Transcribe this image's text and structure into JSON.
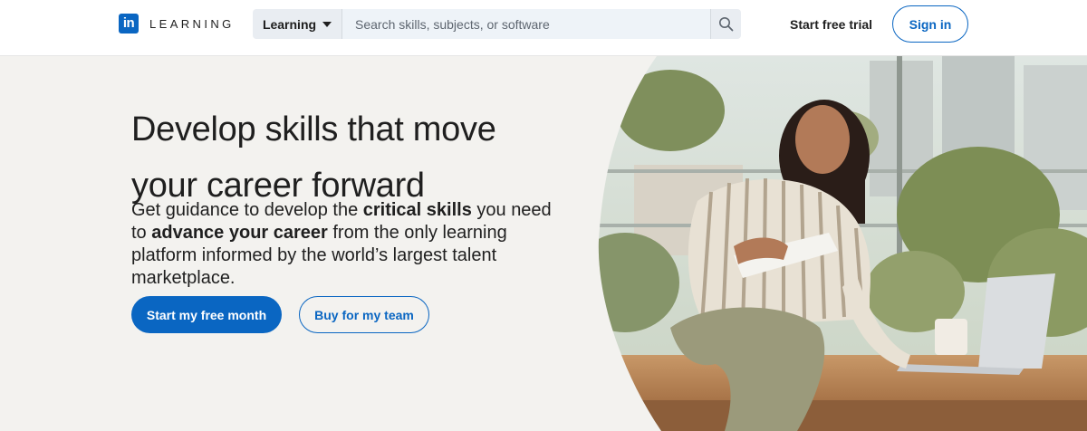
{
  "brand": {
    "logo_mark": "in",
    "name": "LEARNING"
  },
  "search": {
    "dropdown_label": "Learning",
    "placeholder": "Search skills, subjects, or software",
    "icon": "search-icon"
  },
  "nav": {
    "trial_label": "Start free trial",
    "signin_label": "Sign in"
  },
  "hero": {
    "headline": "Develop skills that move your career forward",
    "sub_part1": "Get guidance to develop the ",
    "sub_bold1": "critical skills",
    "sub_part2": " you need to ",
    "sub_bold2": "advance your career",
    "sub_part3": " from the only learning platform informed by the world’s largest talent marketplace.",
    "primary_cta": "Start my free month",
    "secondary_cta": "Buy for my team"
  },
  "colors": {
    "brand_blue": "#0a66c2",
    "hero_bg": "#f3f2ef"
  }
}
